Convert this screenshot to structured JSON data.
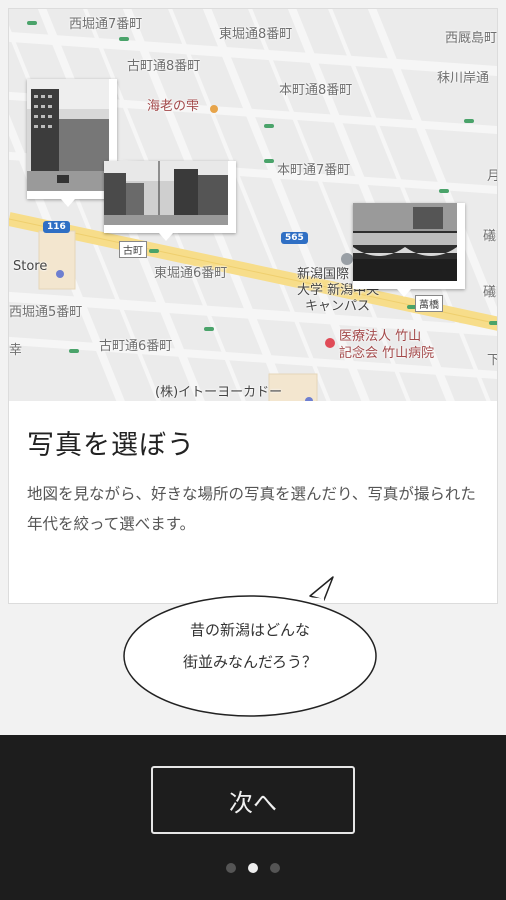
{
  "map": {
    "labels": {
      "nishibori7": "西堀通7番町",
      "higashibori8": "東堀通8番町",
      "nishikoji": "西厩島町",
      "furumachi8": "古町通8番町",
      "honcho8": "本町通8番町",
      "shukawa": "秣川岸通",
      "ebinoshizuku": "海老の雫",
      "honcho7": "本町通7番町",
      "store": "Store",
      "higashibori6": "東堀通6番町",
      "univ1": "新潟国際",
      "univ2": "大学 新潟中央",
      "univ3": "キャンパス",
      "nishibori5": "西堀通5番町",
      "furumachi6": "古町通6番町",
      "hosp1": "医療法人 竹山",
      "hosp2": "記念会 竹山病院",
      "itoyokado": "(株)イトーヨーカドー",
      "edge_tsuru": "月",
      "edge_iso1": "礒町",
      "edge_iso2": "礒町",
      "edge_shimo": "下通",
      "edge_ko": "幸"
    },
    "badges": {
      "route116": "116",
      "route565": "565",
      "furumachi_stop": "古町",
      "bandai_stop": "萬橋"
    }
  },
  "intro": {
    "title": "写真を選ぼう",
    "description": "地図を見ながら、好きな場所の写真を選んだり、写真が撮られた年代を絞って選べます。"
  },
  "bubble": {
    "line1": "昔の新潟はどんな",
    "line2": "街並みなんだろう？"
  },
  "footer": {
    "next_label": "次へ",
    "page_count": 3,
    "current_page": 2
  },
  "colors": {
    "background": "#f2f2f2",
    "footer_bg": "#1d1d1d",
    "map_road_major": "#f7dd8a",
    "map_label_red": "#a3494a",
    "route_badge": "#2f6fc4"
  }
}
